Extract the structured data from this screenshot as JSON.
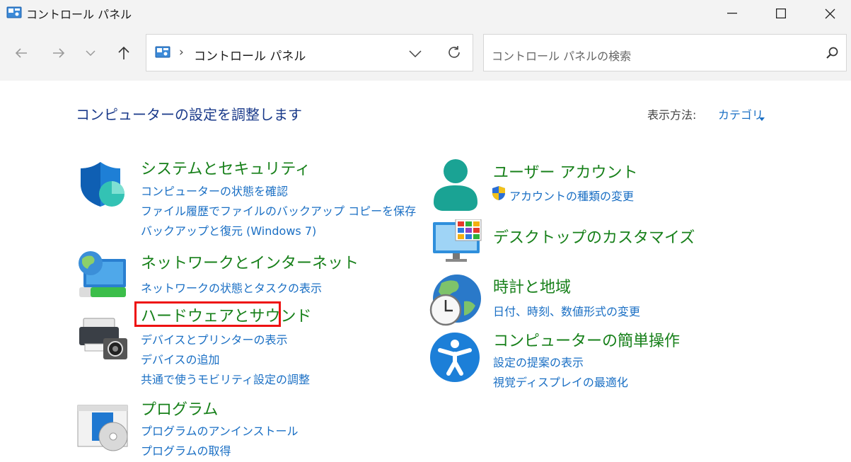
{
  "window": {
    "title": "コントロール パネル",
    "icon": "control-panel-icon"
  },
  "address": {
    "separator": "›",
    "path": "コントロール パネル"
  },
  "search": {
    "placeholder": "コントロール パネルの検索"
  },
  "header": {
    "heading": "コンピューターの設定を調整します",
    "view_by_label": "表示方法:",
    "view_by_value": "カテゴリ"
  },
  "categories": [
    {
      "title": "システムとセキュリティ",
      "icon": "shield-icon",
      "links": [
        "コンピューターの状態を確認",
        "ファイル履歴でファイルのバックアップ コピーを保存",
        "バックアップと復元 (Windows 7)"
      ]
    },
    {
      "title": "ネットワークとインターネット",
      "icon": "network-globe-icon",
      "links": [
        "ネットワークの状態とタスクの表示"
      ]
    },
    {
      "title": "ハードウェアとサウンド",
      "icon": "printer-icon",
      "highlighted": true,
      "links": [
        "デバイスとプリンターの表示",
        "デバイスの追加",
        "共通で使うモビリティ設定の調整"
      ]
    },
    {
      "title": "プログラム",
      "icon": "programs-icon",
      "links": [
        "プログラムのアンインストール",
        "プログラムの取得"
      ]
    },
    {
      "title": "ユーザー アカウント",
      "icon": "user-icon",
      "links": [
        "アカウントの種類の変更"
      ]
    },
    {
      "title": "デスクトップのカスタマイズ",
      "icon": "desktop-icon",
      "links": []
    },
    {
      "title": "時計と地域",
      "icon": "clock-globe-icon",
      "links": [
        "日付、時刻、数値形式の変更"
      ]
    },
    {
      "title": "コンピューターの簡単操作",
      "icon": "accessibility-icon",
      "links": [
        "設定の提案の表示",
        "視覚ディスプレイの最適化"
      ]
    }
  ],
  "colors": {
    "category_title": "#17801a",
    "link": "#1a6fc4",
    "heading": "#1a3a8a",
    "highlight": "#e11111"
  }
}
